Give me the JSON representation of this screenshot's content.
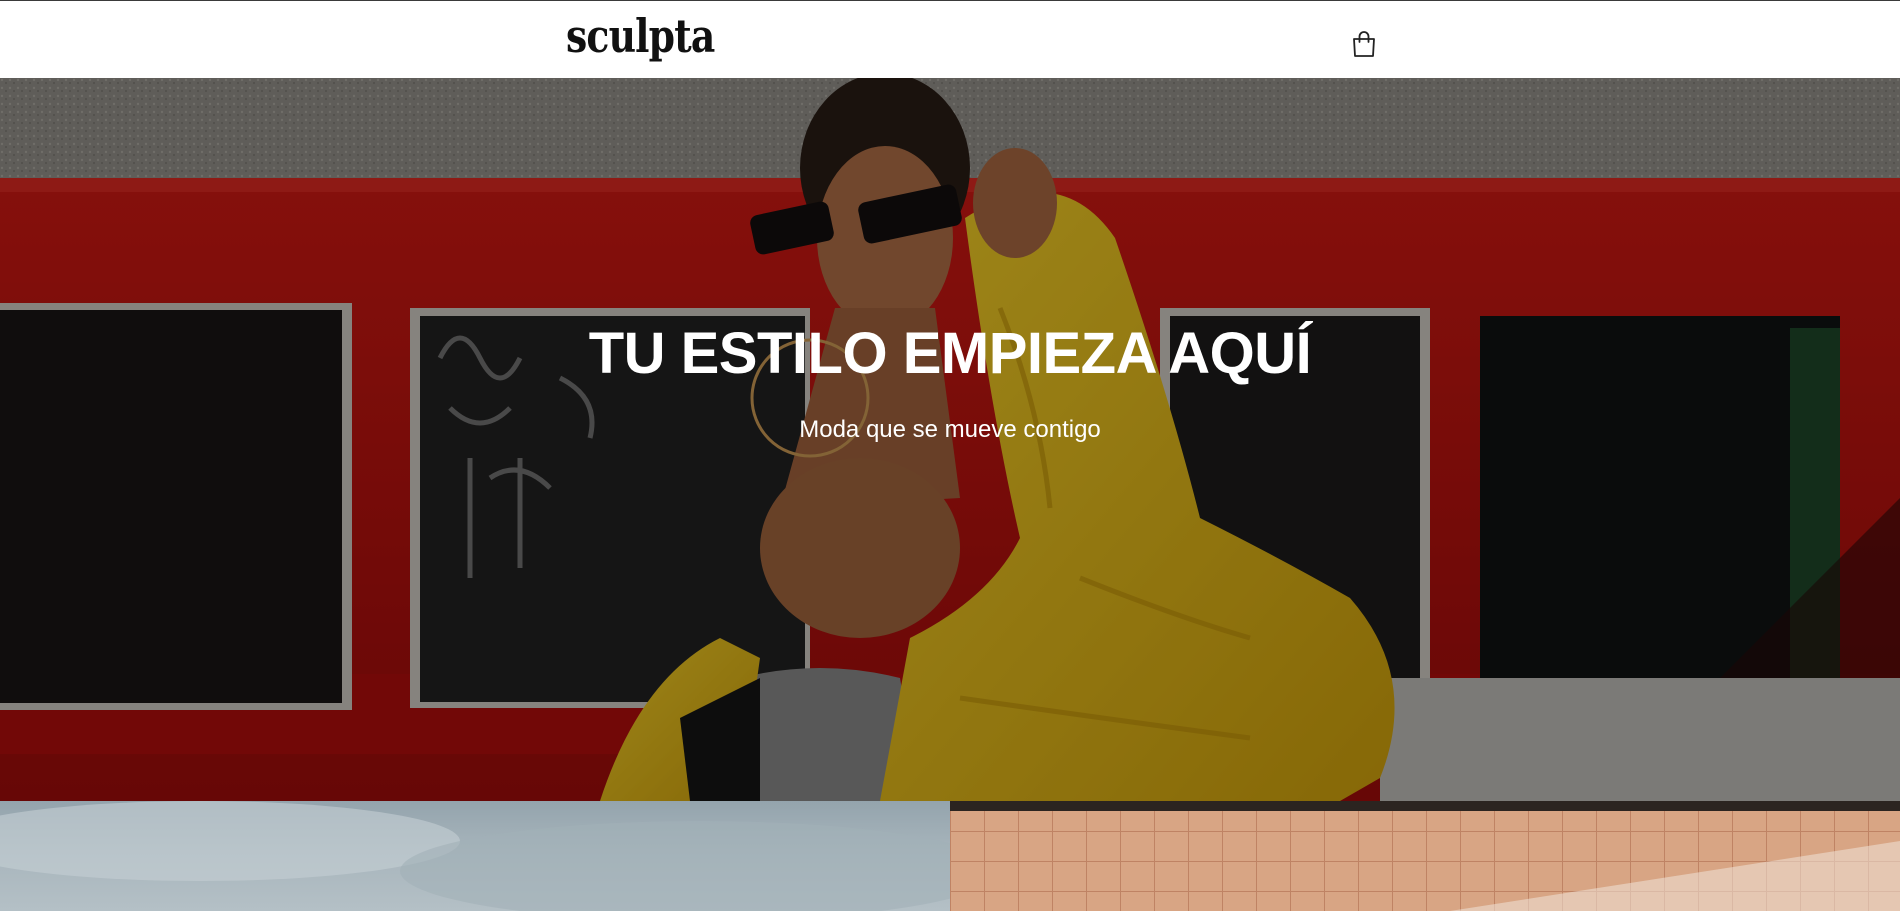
{
  "header": {
    "logo_text": "sculpta",
    "cart_icon": "shopping-bag-icon"
  },
  "hero": {
    "title": "TU ESTILO EMPIEZA AQUÍ",
    "subtitle": "Moda que se mueve contigo"
  },
  "colors": {
    "header_bg": "#ffffff",
    "text_dark": "#111111",
    "hero_text": "#ffffff",
    "wall_red": "#c41010",
    "jacket_yellow": "#f2c418"
  }
}
